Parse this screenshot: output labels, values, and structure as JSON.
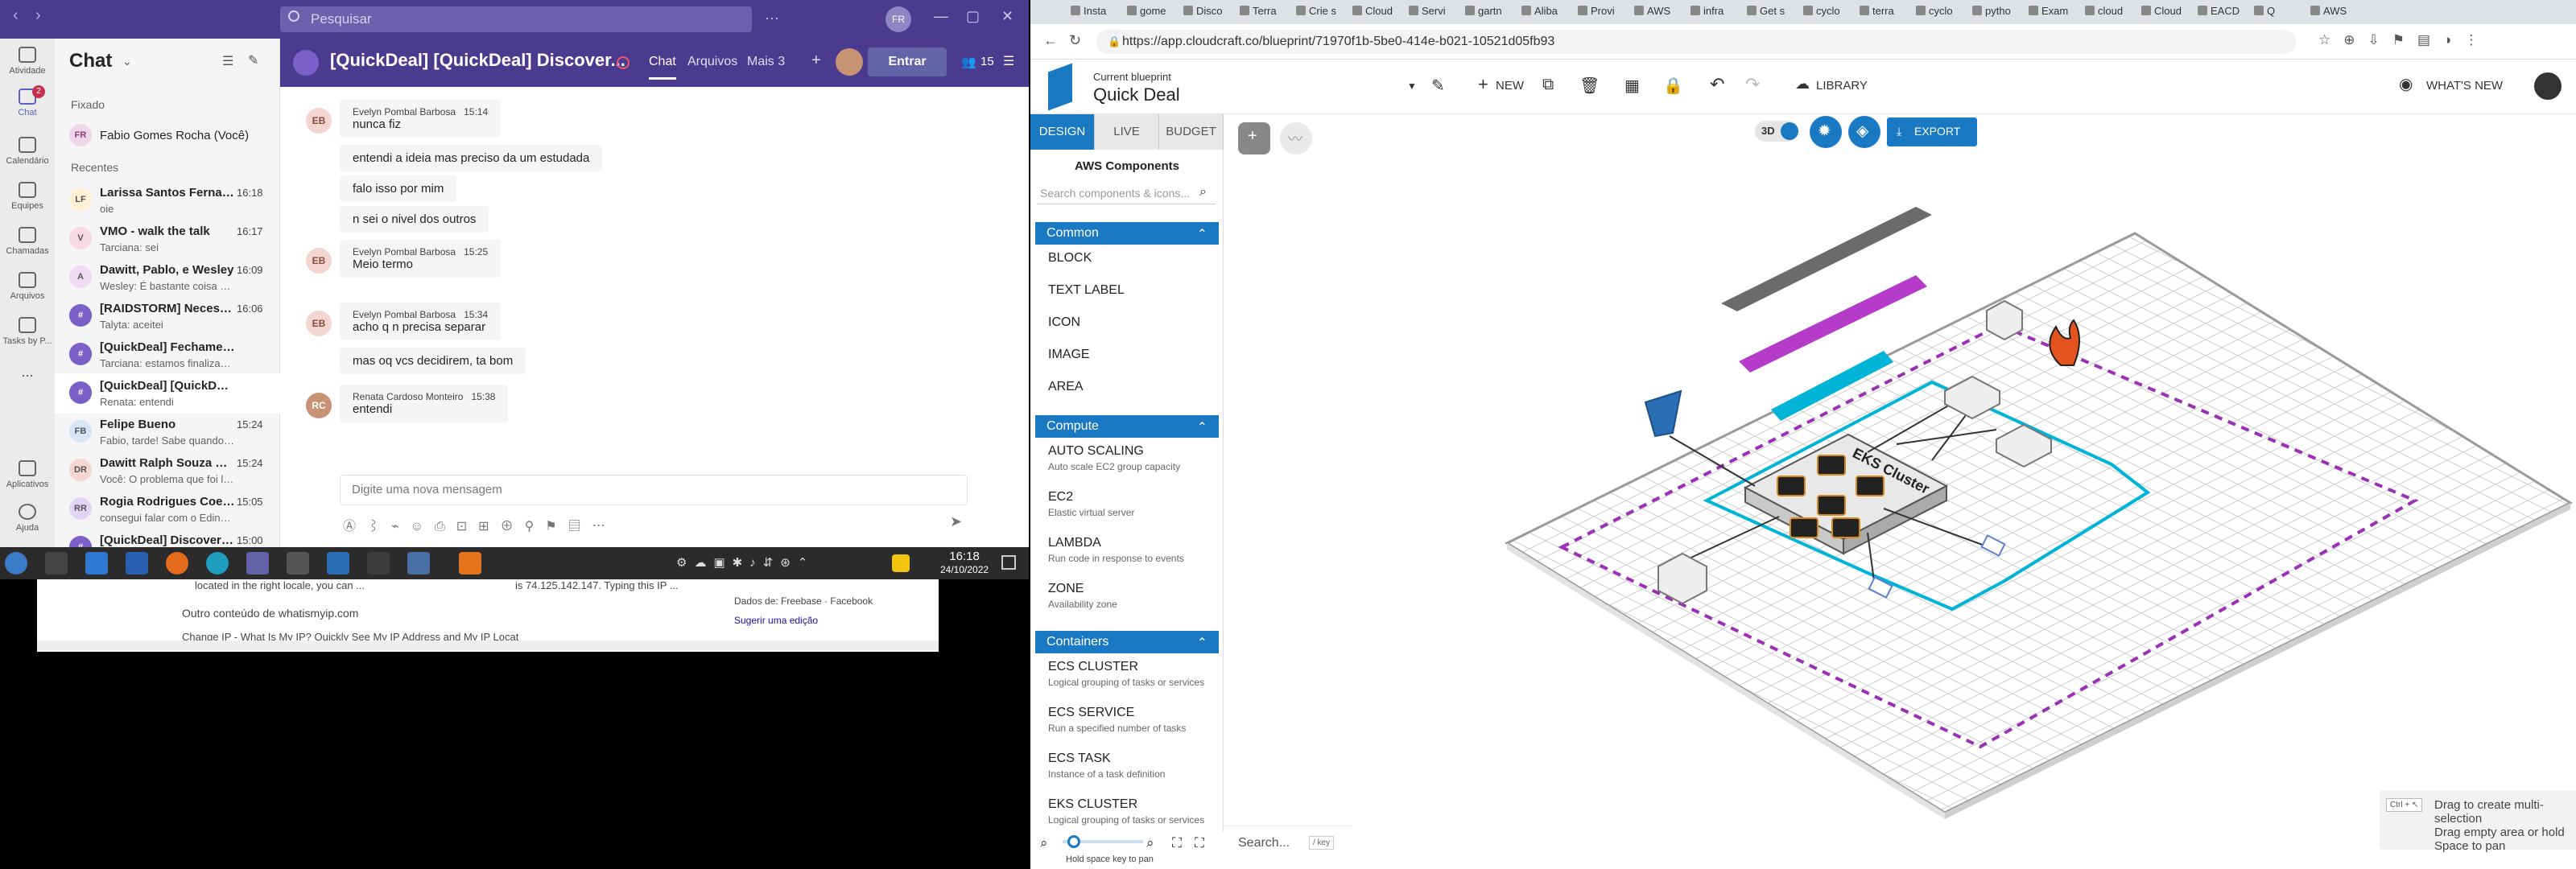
{
  "teams": {
    "search_placeholder": "Pesquisar",
    "window_controls": [
      "—",
      "▢",
      "✕"
    ],
    "rail": [
      {
        "label": "Atividade",
        "icon": "bell-icon"
      },
      {
        "label": "Chat",
        "icon": "chat-icon",
        "badge": "2"
      },
      {
        "label": "Calendário",
        "icon": "calendar-icon"
      },
      {
        "label": "Equipes",
        "icon": "teams-icon"
      },
      {
        "label": "Chamadas",
        "icon": "phone-icon"
      },
      {
        "label": "Arquivos",
        "icon": "file-icon"
      },
      {
        "label": "Tasks by P...",
        "icon": "tasks-icon"
      },
      {
        "label": "...",
        "icon": "more-icon"
      },
      {
        "label": "Aplicativos",
        "icon": "apps-icon"
      },
      {
        "label": "Ajuda",
        "icon": "help-icon"
      }
    ],
    "chat_list": {
      "title": "Chat",
      "pinned_label": "Fixado",
      "pinned": {
        "initials": "FR",
        "name": "Fabio Gomes Rocha (Você)"
      },
      "recent_label": "Recentes",
      "items": [
        {
          "initials": "LF",
          "name": "Larissa Santos Fernan...",
          "time": "16:18",
          "preview": "oie"
        },
        {
          "initials": "V",
          "name": "VMO - walk the talk",
          "time": "16:17",
          "preview": "Tarciana: sei"
        },
        {
          "initials": "A",
          "name": "Dawitt, Pablo, e Wesley",
          "time": "16:09",
          "preview": "Wesley: É bastante coisa hein..."
        },
        {
          "initials": "#",
          "name": "[RAIDSTORM] Necessi...",
          "time": "16:06",
          "preview": "Talyta: aceitei"
        },
        {
          "initials": "#",
          "name": "[QuickDeal] Fechamento ...",
          "time": "",
          "preview": "Tarciana: estamos finalizando"
        },
        {
          "initials": "#",
          "name": "[QuickDeal] [QuickDeal] Di...",
          "time": "",
          "preview": "Renata: entendi"
        },
        {
          "initials": "FB",
          "name": "Felipe Bueno",
          "time": "15:24",
          "preview": "Fabio, tarde! Sabe quando sai..."
        },
        {
          "initials": "DR",
          "name": "Dawitt Ralph Souza Sa...",
          "time": "15:24",
          "preview": "Você: O problema que foi leva..."
        },
        {
          "initials": "RR",
          "name": "Rogia Rodrigues Coel...",
          "time": "15:05",
          "preview": "consegui falar com o Edinald..."
        },
        {
          "initials": "#",
          "name": "[QuickDeal] Discovery ...",
          "time": "15:00",
          "preview": ""
        }
      ]
    },
    "conversation": {
      "title": "[QuickDeal] [QuickDeal] Discover...",
      "tabs": [
        "Chat",
        "Arquivos",
        "Mais 3"
      ],
      "enter_label": "Entrar",
      "participants": "15",
      "messages": [
        {
          "initials": "EB",
          "author": "Evelyn Pombal Barbosa",
          "time": "15:14",
          "lines": [
            "nunca fiz",
            "entendi a ideia mas preciso da um estudada",
            "falo isso por mim",
            "n sei o nivel dos outros"
          ]
        },
        {
          "initials": "EB",
          "author": "Evelyn Pombal Barbosa",
          "time": "15:25",
          "lines": [
            "Meio termo"
          ]
        },
        {
          "initials": "EB",
          "author": "Evelyn Pombal Barbosa",
          "time": "15:34",
          "lines": [
            "acho q n precisa separar",
            "mas oq vcs decidirem, ta bom"
          ]
        },
        {
          "initials": "RC",
          "author": "Renata Cardoso Monteiro",
          "time": "15:38",
          "lines": [
            "entendi"
          ]
        }
      ],
      "input_placeholder": "Digite uma nova mensagem"
    },
    "taskbar": {
      "time": "16:18",
      "date": "24/10/2022"
    },
    "browser_fragment": {
      "line1": "located in the right locale, you can ...",
      "line1b": "is 74.125.142.147. Typing this IP ...",
      "line2": "Outro conteúdo de whatismyip.com",
      "line3": "Change IP - What Is My IP? Quickly See My IP Address and My IP Locat",
      "src_label": "Dados de: Freebase · Facebook",
      "suggest": "Sugerir uma edição"
    }
  },
  "chrome": {
    "tabs": [
      "Insta",
      "gome",
      "Disco",
      "Terra",
      "Crie s",
      "Cloud",
      "Servi",
      "gartn",
      "Aliba",
      "Provi",
      "AWS",
      "infra",
      "Get s",
      "cyclo",
      "terra",
      "cyclo",
      "pytho",
      "Exam",
      "cloud",
      "Cloud",
      "EACD",
      "Q",
      "AWS"
    ],
    "url": "https://app.cloudcraft.co/blueprint/71970f1b-5be0-414e-b021-10521d05fb93"
  },
  "cloudcraft": {
    "current_label": "Current blueprint",
    "blueprint_name": "Quick Deal",
    "new_label": "NEW",
    "library_label": "LIBRARY",
    "whats_new": "WHAT'S NEW",
    "export_label": "EXPORT",
    "view_3d": "3D",
    "side_tabs": [
      "DESIGN",
      "LIVE",
      "BUDGET"
    ],
    "aws_title": "AWS Components",
    "search_placeholder": "Search components & icons...",
    "categories": [
      {
        "name": "Common",
        "items": [
          {
            "name": "BLOCK",
            "desc": ""
          },
          {
            "name": "TEXT LABEL",
            "desc": ""
          },
          {
            "name": "ICON",
            "desc": ""
          },
          {
            "name": "IMAGE",
            "desc": ""
          },
          {
            "name": "AREA",
            "desc": ""
          }
        ]
      },
      {
        "name": "Compute",
        "items": [
          {
            "name": "AUTO SCALING",
            "desc": "Auto scale EC2 group capacity"
          },
          {
            "name": "EC2",
            "desc": "Elastic virtual server"
          },
          {
            "name": "LAMBDA",
            "desc": "Run code in response to events"
          },
          {
            "name": "ZONE",
            "desc": "Availability zone"
          }
        ]
      },
      {
        "name": "Containers",
        "items": [
          {
            "name": "ECS CLUSTER",
            "desc": "Logical grouping of tasks or services"
          },
          {
            "name": "ECS SERVICE",
            "desc": "Run a specified number of tasks"
          },
          {
            "name": "ECS TASK",
            "desc": "Instance of a task definition"
          },
          {
            "name": "EKS CLUSTER",
            "desc": "Logical grouping of tasks or services"
          }
        ]
      }
    ],
    "eks_label": "EKS Cluster",
    "footer_search": "Search...",
    "footer_key": "/ key",
    "hold_space": "Hold space key to pan",
    "hint1_key": "Ctrl + ↖",
    "hint1": "Drag to create multi-selection",
    "hint2": "Drag empty area or hold Space to pan",
    "colors": {
      "accent": "#1979c3",
      "teams": "#4b3b8f",
      "vpc": "#00b4d8",
      "subnet": "#9b2fb5"
    }
  }
}
